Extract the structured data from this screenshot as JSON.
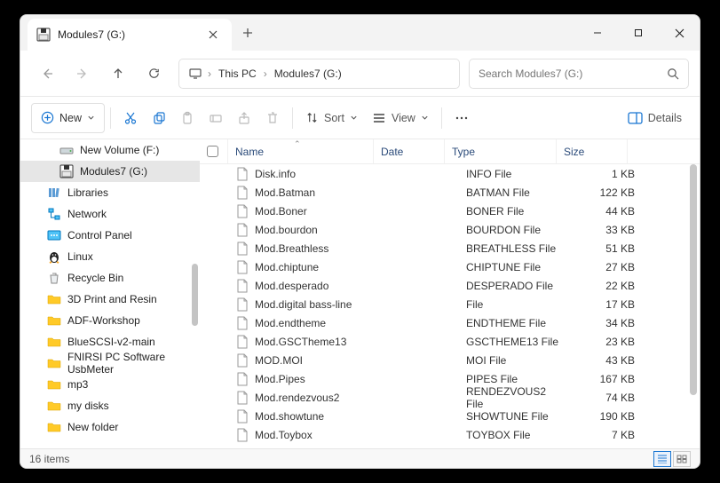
{
  "window": {
    "title": "Modules7 (G:)"
  },
  "address": {
    "monitor": true,
    "segments": [
      "This PC",
      "Modules7 (G:)"
    ]
  },
  "search": {
    "placeholder": "Search Modules7 (G:)"
  },
  "toolbar": {
    "new": "New",
    "sort": "Sort",
    "view": "View",
    "details": "Details"
  },
  "sidebar": {
    "items": [
      {
        "label": "New Volume (F:)",
        "icon": "drive",
        "indent": 0
      },
      {
        "label": "Modules7 (G:)",
        "icon": "floppy",
        "indent": 0,
        "selected": true
      },
      {
        "label": "Libraries",
        "icon": "libraries",
        "indent": -1
      },
      {
        "label": "Network",
        "icon": "network",
        "indent": -1
      },
      {
        "label": "Control Panel",
        "icon": "cpanel",
        "indent": -1
      },
      {
        "label": "Linux",
        "icon": "linux",
        "indent": -1
      },
      {
        "label": "Recycle Bin",
        "icon": "recycle",
        "indent": -1
      },
      {
        "label": "3D Print and Resin",
        "icon": "folder",
        "indent": -1
      },
      {
        "label": "ADF-Workshop",
        "icon": "folder",
        "indent": -1
      },
      {
        "label": "BlueSCSI-v2-main",
        "icon": "folder",
        "indent": -1
      },
      {
        "label": "FNIRSI PC Software UsbMeter",
        "icon": "folder",
        "indent": -1
      },
      {
        "label": "mp3",
        "icon": "folder",
        "indent": -1
      },
      {
        "label": "my disks",
        "icon": "folder",
        "indent": -1
      },
      {
        "label": "New folder",
        "icon": "folder",
        "indent": -1
      }
    ]
  },
  "columns": {
    "name": "Name",
    "date": "Date",
    "type": "Type",
    "size": "Size"
  },
  "files": [
    {
      "name": "Disk.info",
      "type": "INFO File",
      "size": "1 KB"
    },
    {
      "name": "Mod.Batman",
      "type": "BATMAN File",
      "size": "122 KB"
    },
    {
      "name": "Mod.Boner",
      "type": "BONER File",
      "size": "44 KB"
    },
    {
      "name": "Mod.bourdon",
      "type": "BOURDON File",
      "size": "33 KB"
    },
    {
      "name": "Mod.Breathless",
      "type": "BREATHLESS File",
      "size": "51 KB"
    },
    {
      "name": "Mod.chiptune",
      "type": "CHIPTUNE File",
      "size": "27 KB"
    },
    {
      "name": "Mod.desperado",
      "type": "DESPERADO File",
      "size": "22 KB"
    },
    {
      "name": "Mod.digital bass-line",
      "type": "File",
      "size": "17 KB"
    },
    {
      "name": "Mod.endtheme",
      "type": "ENDTHEME File",
      "size": "34 KB"
    },
    {
      "name": "Mod.GSCTheme13",
      "type": "GSCTHEME13 File",
      "size": "23 KB"
    },
    {
      "name": "MOD.MOI",
      "type": "MOI File",
      "size": "43 KB"
    },
    {
      "name": "Mod.Pipes",
      "type": "PIPES File",
      "size": "167 KB"
    },
    {
      "name": "Mod.rendezvous2",
      "type": "RENDEZVOUS2 File",
      "size": "74 KB"
    },
    {
      "name": "Mod.showtune",
      "type": "SHOWTUNE File",
      "size": "190 KB"
    },
    {
      "name": "Mod.Toybox",
      "type": "TOYBOX File",
      "size": "7 KB"
    }
  ],
  "status": {
    "text": "16 items"
  }
}
